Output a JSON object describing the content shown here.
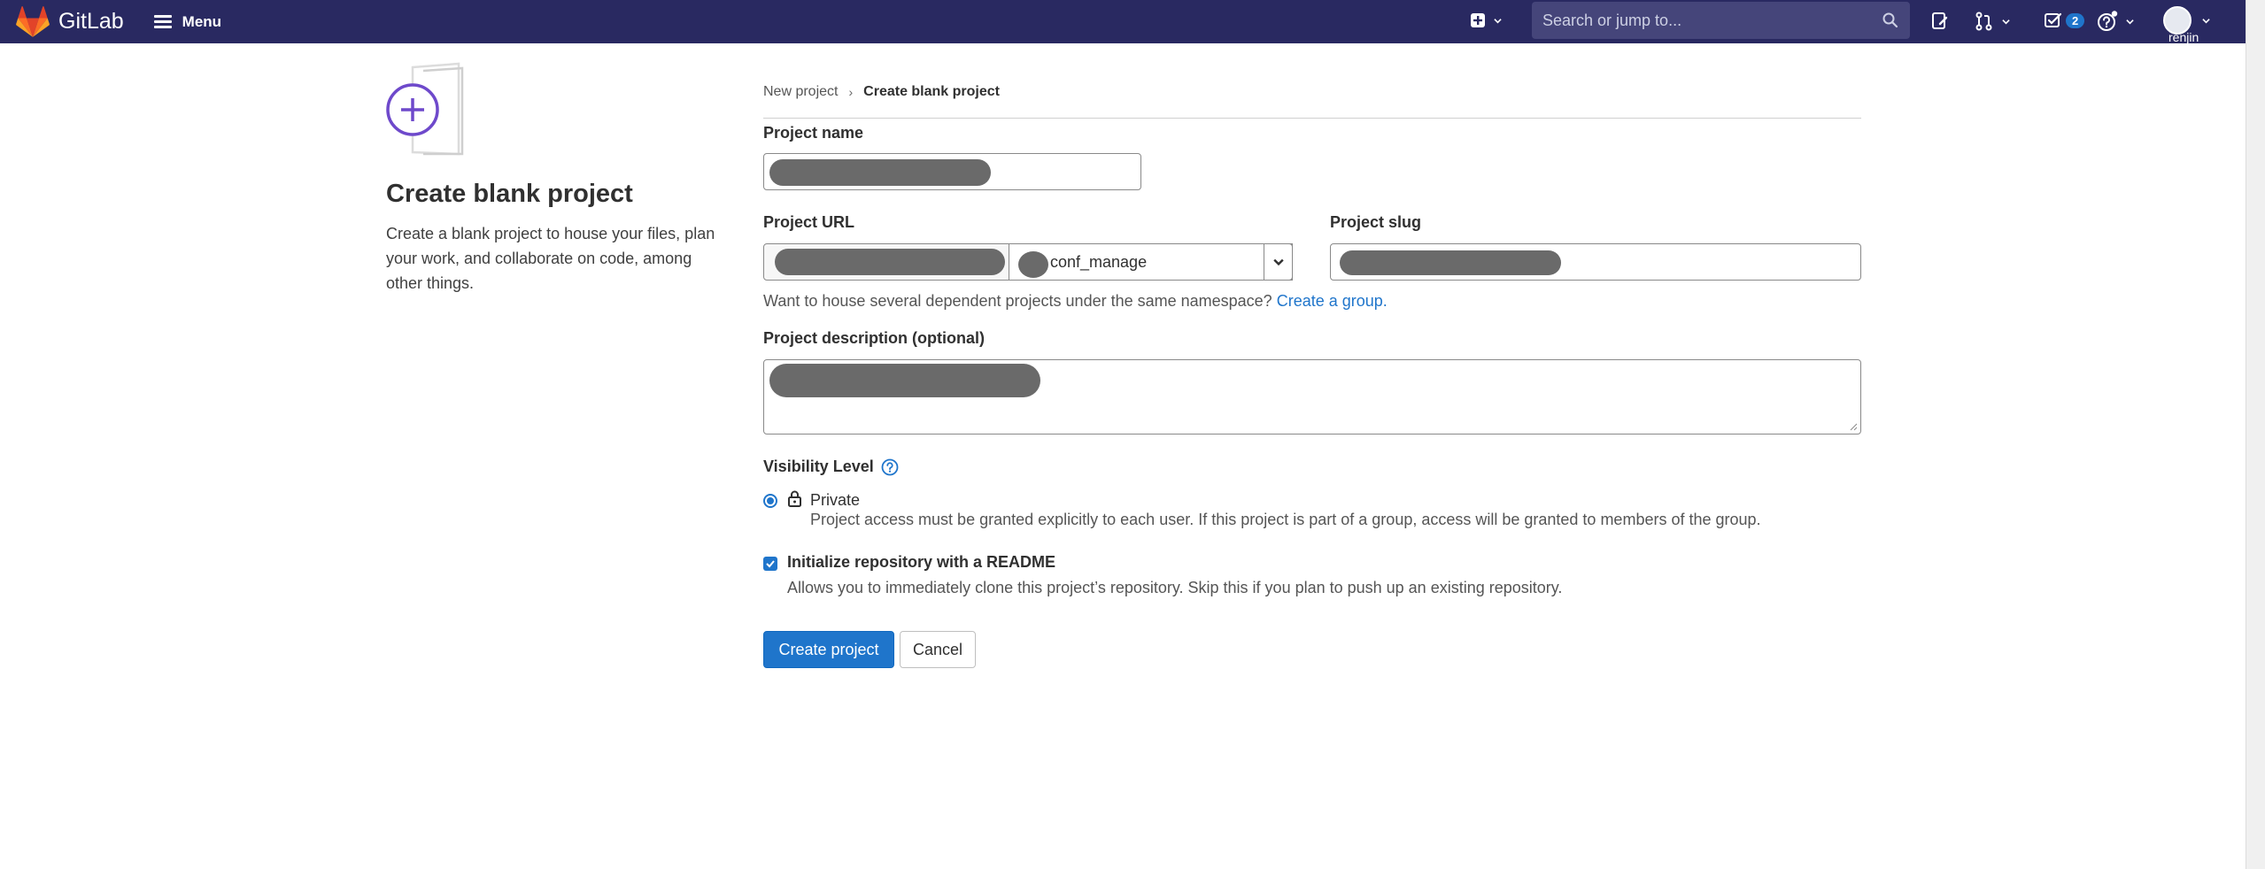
{
  "navbar": {
    "brand": "GitLab",
    "menu_label": "Menu",
    "search_placeholder": "Search or jump to...",
    "todo_count": "2",
    "user": "renjin"
  },
  "left": {
    "title": "Create blank project",
    "description": "Create a blank project to house your files, plan your work, and collaborate on code, among other things."
  },
  "breadcrumb": {
    "parent": "New project",
    "current": "Create blank project"
  },
  "form": {
    "project_name_label": "Project name",
    "project_url_label": "Project URL",
    "namespace_value": "conf_manage",
    "project_slug_label": "Project slug",
    "namespace_hint": "Want to house several dependent projects under the same namespace?",
    "create_group_link": "Create a group.",
    "description_label": "Project description (optional)",
    "visibility_label": "Visibility Level",
    "visibility": {
      "private_label": "Private",
      "private_help": "Project access must be granted explicitly to each user. If this project is part of a group, access will be granted to members of the group.",
      "selected": "Private"
    },
    "readme_label": "Initialize repository with a README",
    "readme_help": "Allows you to immediately clone this project’s repository. Skip this if you plan to push up an existing repository.",
    "readme_checked": true
  },
  "buttons": {
    "create": "Create project",
    "cancel": "Cancel"
  },
  "colors": {
    "navbar_bg": "#292961",
    "primary": "#1f75cb",
    "text": "#303030"
  }
}
